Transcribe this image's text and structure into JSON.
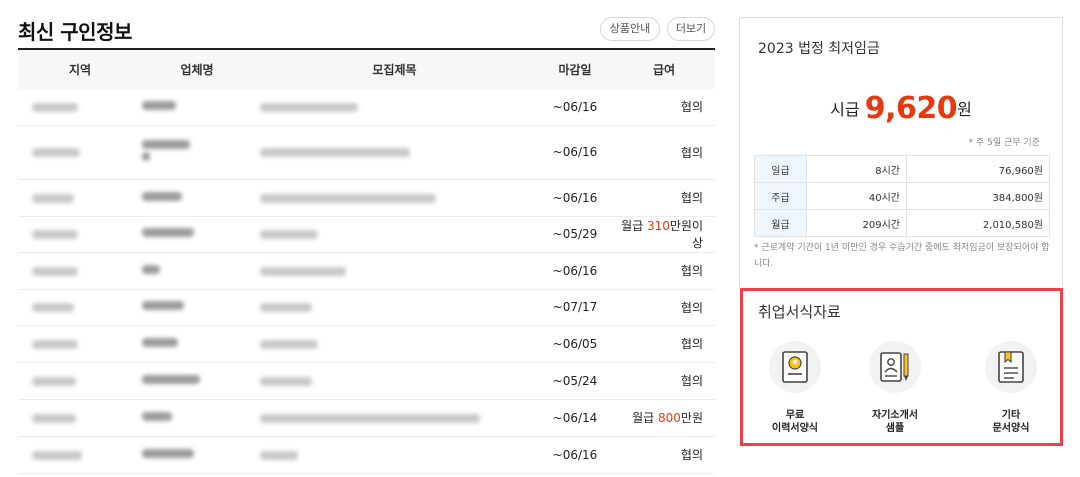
{
  "jobs": {
    "title": "최신 구인정보",
    "guide_button": "상품안내",
    "more_button": "더보기",
    "columns": [
      "지역",
      "업체명",
      "모집제목",
      "마감일",
      "급여"
    ],
    "rows": [
      {
        "deadline": "~06/16",
        "pay_pre": "",
        "pay_num": "",
        "pay_post": "협의"
      },
      {
        "deadline": "~06/16",
        "pay_pre": "",
        "pay_num": "",
        "pay_post": "협의"
      },
      {
        "deadline": "~06/16",
        "pay_pre": "",
        "pay_num": "",
        "pay_post": "협의"
      },
      {
        "deadline": "~05/29",
        "pay_pre": "월급 ",
        "pay_num": "310",
        "pay_post": "만원이상"
      },
      {
        "deadline": "~06/16",
        "pay_pre": "",
        "pay_num": "",
        "pay_post": "협의"
      },
      {
        "deadline": "~07/17",
        "pay_pre": "",
        "pay_num": "",
        "pay_post": "협의"
      },
      {
        "deadline": "~06/05",
        "pay_pre": "",
        "pay_num": "",
        "pay_post": "협의"
      },
      {
        "deadline": "~05/24",
        "pay_pre": "",
        "pay_num": "",
        "pay_post": "협의"
      },
      {
        "deadline": "~06/14",
        "pay_pre": "월급 ",
        "pay_num": "800",
        "pay_post": "만원"
      },
      {
        "deadline": "~06/16",
        "pay_pre": "",
        "pay_num": "",
        "pay_post": "협의"
      }
    ]
  },
  "wage": {
    "title": "2023 법정 최저임금",
    "rate_prefix": "시급 ",
    "rate_value": "9,620",
    "rate_suffix": "원",
    "note": "* 주 5일 근무 기준",
    "table": [
      {
        "kind": "일급",
        "hours": "8시간",
        "amount": "76,960원"
      },
      {
        "kind": "주급",
        "hours": "40시간",
        "amount": "384,800원"
      },
      {
        "kind": "월급",
        "hours": "209시간",
        "amount": "2,010,580원"
      }
    ],
    "footnote": "* 근로계약 기간이 1년 미만인 경우 수습기간 중에도 최저임금이 보장되어야 합니다."
  },
  "forms": {
    "title": "취업서식자료",
    "items": [
      {
        "line1": "무료",
        "line2": "이력서양식",
        "icon": "resume-icon"
      },
      {
        "line1": "자기소개서",
        "line2": "샘플",
        "icon": "cover-letter-icon"
      },
      {
        "line1": "기타",
        "line2": "문서양식",
        "icon": "document-icon"
      }
    ]
  },
  "colors": {
    "accent": "#e8380d",
    "highlight_border": "#ef3f4a"
  }
}
